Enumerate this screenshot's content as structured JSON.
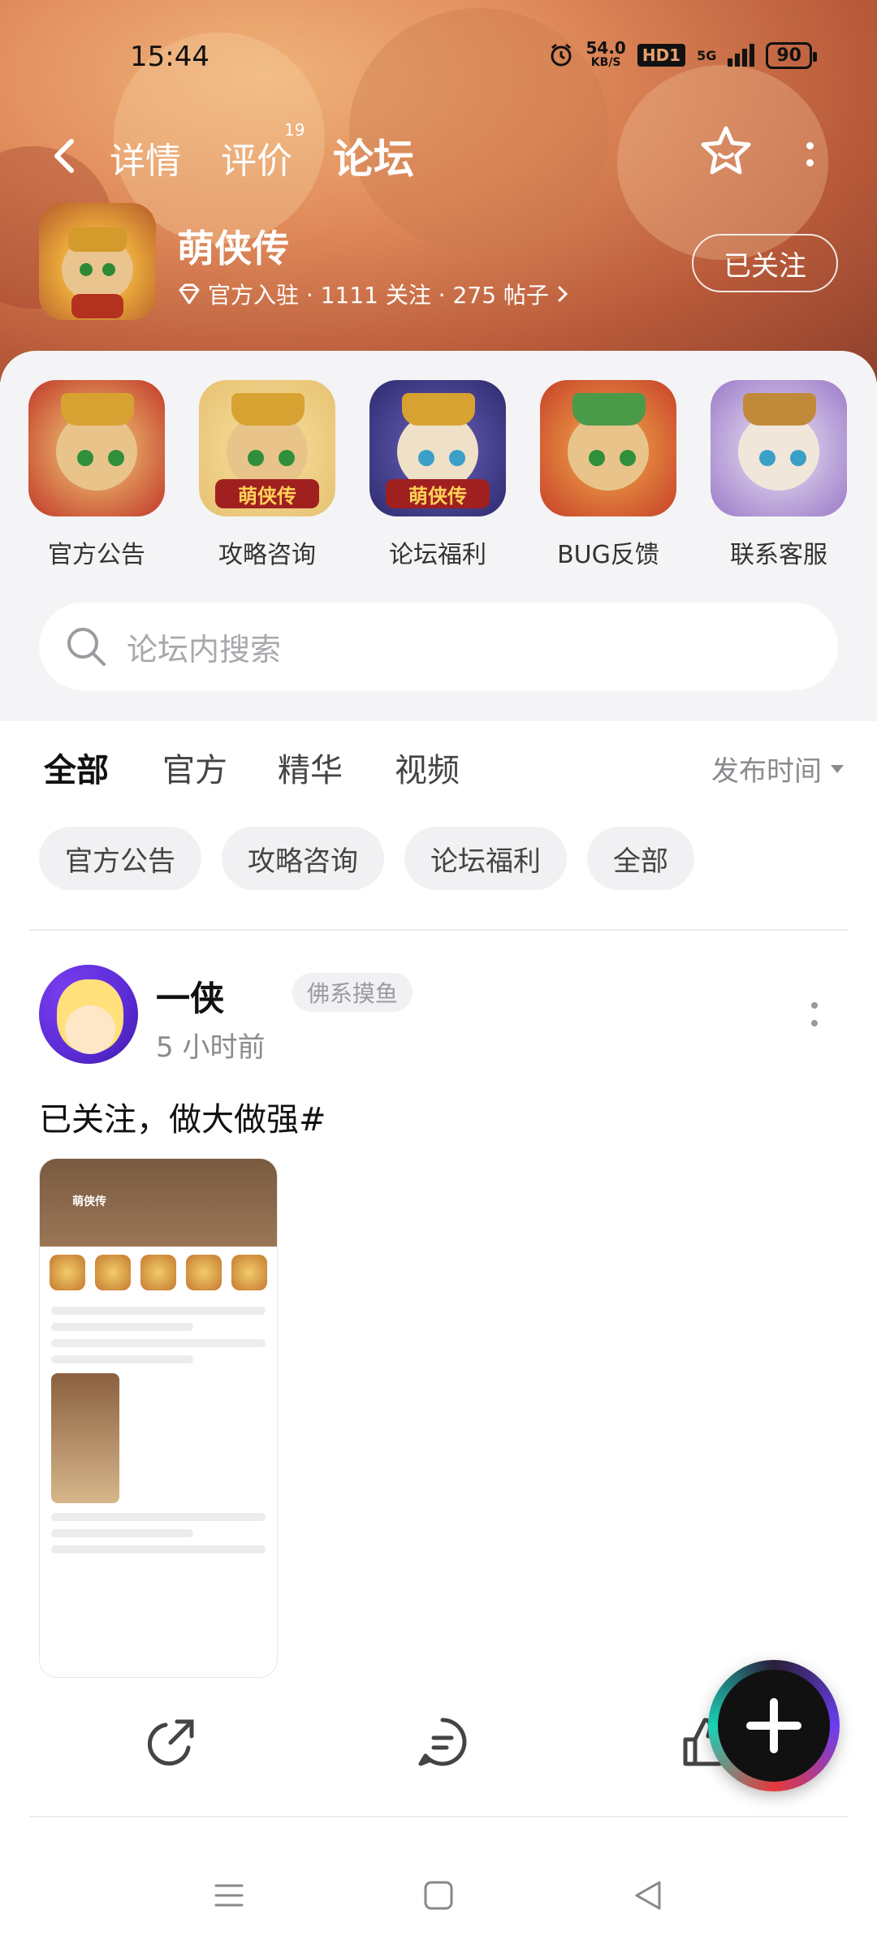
{
  "status_bar": {
    "time": "15:44",
    "net_speed_value": "54.0",
    "net_speed_unit": "KB/S",
    "hd_label": "HD1",
    "net_type": "5G",
    "battery": "90"
  },
  "nav": {
    "tabs": [
      {
        "label": "详情"
      },
      {
        "label": "评价"
      },
      {
        "label": "论坛"
      }
    ],
    "review_count": "19",
    "active_tab": "论坛"
  },
  "game": {
    "name": "萌侠传",
    "meta": "官方入驻 · 1111 关注 · 275 帖子",
    "follow_label": "已关注"
  },
  "categories": [
    {
      "label": "官方公告",
      "badge": ""
    },
    {
      "label": "攻略咨询",
      "badge": "萌侠传"
    },
    {
      "label": "论坛福利",
      "badge": "萌侠传"
    },
    {
      "label": "BUG反馈",
      "badge": ""
    },
    {
      "label": "联系客服",
      "badge": ""
    }
  ],
  "search": {
    "placeholder": "论坛内搜索"
  },
  "filter_tabs": [
    {
      "label": "全部"
    },
    {
      "label": "官方"
    },
    {
      "label": "精华"
    },
    {
      "label": "视频"
    }
  ],
  "sort_label": "发布时间",
  "chips": [
    {
      "label": "官方公告"
    },
    {
      "label": "攻略咨询"
    },
    {
      "label": "论坛福利"
    },
    {
      "label": "全部"
    }
  ],
  "post": {
    "author": "一侠",
    "author_tag": "佛系摸鱼",
    "time": "5 小时前",
    "text": "已关注，做大做强#",
    "image_title": "萌侠传"
  },
  "colors": {
    "accent": "#1ad1b8",
    "hero": "#c8724a"
  }
}
